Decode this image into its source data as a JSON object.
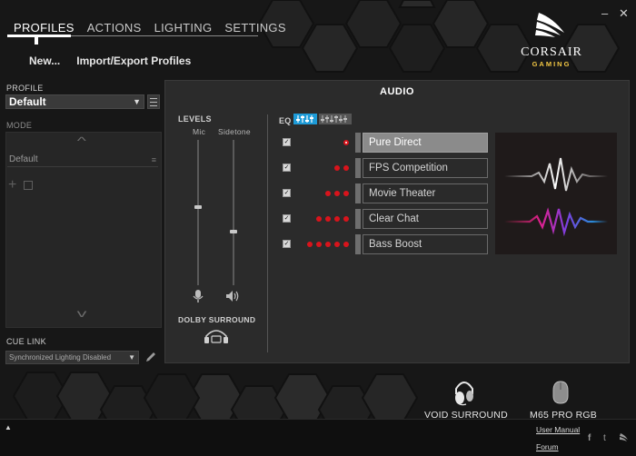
{
  "nav": {
    "tabs": [
      {
        "label": "PROFILES",
        "active": true
      },
      {
        "label": "ACTIONS",
        "active": false
      },
      {
        "label": "LIGHTING",
        "active": false
      },
      {
        "label": "SETTINGS",
        "active": false
      }
    ],
    "sub": [
      "New...",
      "Import/Export Profiles"
    ]
  },
  "window": {
    "minimize": "–",
    "close": "✕"
  },
  "logo": {
    "brand": "CORSAIR",
    "sub": "GAMING"
  },
  "left": {
    "profile_label": "PROFILE",
    "profile_value": "Default",
    "mode_label": "MODE",
    "mode_item": "Default",
    "cue_link_label": "CUE LINK",
    "cue_link_value": "Synchronized Lighting Disabled"
  },
  "audio": {
    "title": "AUDIO",
    "levels_label": "LEVELS",
    "mic_label": "Mic",
    "sidetone_label": "Sidetone",
    "mic_level": 0.55,
    "sidetone_level": 0.38,
    "dolby_label": "DOLBY SURROUND",
    "eq_label": "EQ",
    "presets": [
      {
        "label": "Pure Direct",
        "dots": 1,
        "active": true
      },
      {
        "label": "FPS Competition",
        "dots": 2,
        "active": false
      },
      {
        "label": "Movie Theater",
        "dots": 3,
        "active": false
      },
      {
        "label": "Clear Chat",
        "dots": 4,
        "active": false
      },
      {
        "label": "Bass Boost",
        "dots": 5,
        "active": false
      }
    ]
  },
  "devices": [
    {
      "label": "VOID SURROUND"
    },
    {
      "label": "M65 PRO RGB"
    }
  ],
  "footer": {
    "user_manual": "User Manual",
    "forum": "Forum",
    "social": [
      "f",
      "t"
    ]
  },
  "colors": {
    "accent_red": "#d8141c",
    "eq_blue": "#1e9bd7",
    "logo_gold": "#f2c744"
  }
}
